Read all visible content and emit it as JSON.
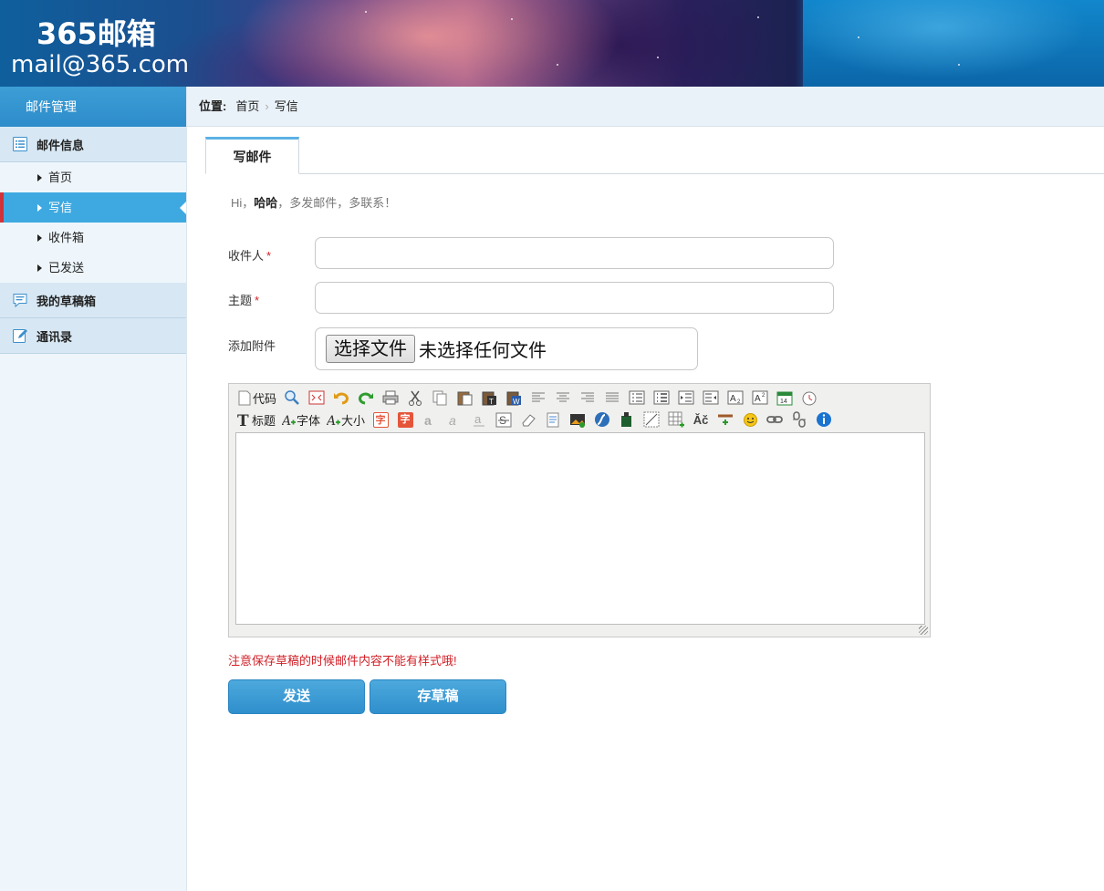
{
  "header": {
    "title": "365邮箱",
    "email": "mail@365.com"
  },
  "sidebar": {
    "title": "邮件管理",
    "groups": [
      {
        "label": "邮件信息",
        "icon": "list-icon",
        "items": [
          {
            "label": "首页"
          },
          {
            "label": "写信",
            "active": true
          },
          {
            "label": "收件箱"
          },
          {
            "label": "已发送"
          }
        ]
      },
      {
        "label": "我的草稿箱",
        "icon": "chat-bubble-icon"
      },
      {
        "label": "通讯录",
        "icon": "edit-icon"
      }
    ]
  },
  "breadcrumb": {
    "prefix": "位置:",
    "items": [
      "首页",
      "写信"
    ],
    "separator": "›"
  },
  "tab": {
    "label": "写邮件"
  },
  "greeting": {
    "pre": "Hi，",
    "name": "哈哈",
    "post": "，多发邮件，多联系！"
  },
  "form": {
    "recipient_label": "收件人",
    "subject_label": "主题",
    "required_mark": "*",
    "attachment_label": "添加附件",
    "file_button": "选择文件",
    "file_status": "未选择任何文件",
    "recipient_value": "",
    "subject_value": ""
  },
  "editor": {
    "toolbar_row1": [
      "source-code-icon",
      "preview-icon",
      "maximize-icon",
      "undo-icon",
      "redo-icon",
      "print-icon",
      "cut-icon",
      "copy-icon",
      "paste-icon",
      "paste-text-icon",
      "paste-word-icon",
      "align-left-icon",
      "align-center-icon",
      "align-right-icon",
      "justify-icon",
      "ordered-list-icon",
      "unordered-list-icon",
      "indent-icon",
      "outdent-icon",
      "subscript-icon",
      "superscript-icon",
      "date-icon",
      "time-icon"
    ],
    "code_label": "代码",
    "heading_label": "标题",
    "font_label": "字体",
    "size_label": "大小",
    "text_color_glyph": "字",
    "bg_color_glyph": "字",
    "special_char_glyph": "Ǎč"
  },
  "warning": "注意保存草稿的时候邮件内容不能有样式哦!",
  "buttons": {
    "send": "发送",
    "save_draft": "存草稿"
  },
  "colors": {
    "accent": "#3ea9e0",
    "sidebar_bg": "#eef6fc",
    "warning": "#d01f26"
  }
}
